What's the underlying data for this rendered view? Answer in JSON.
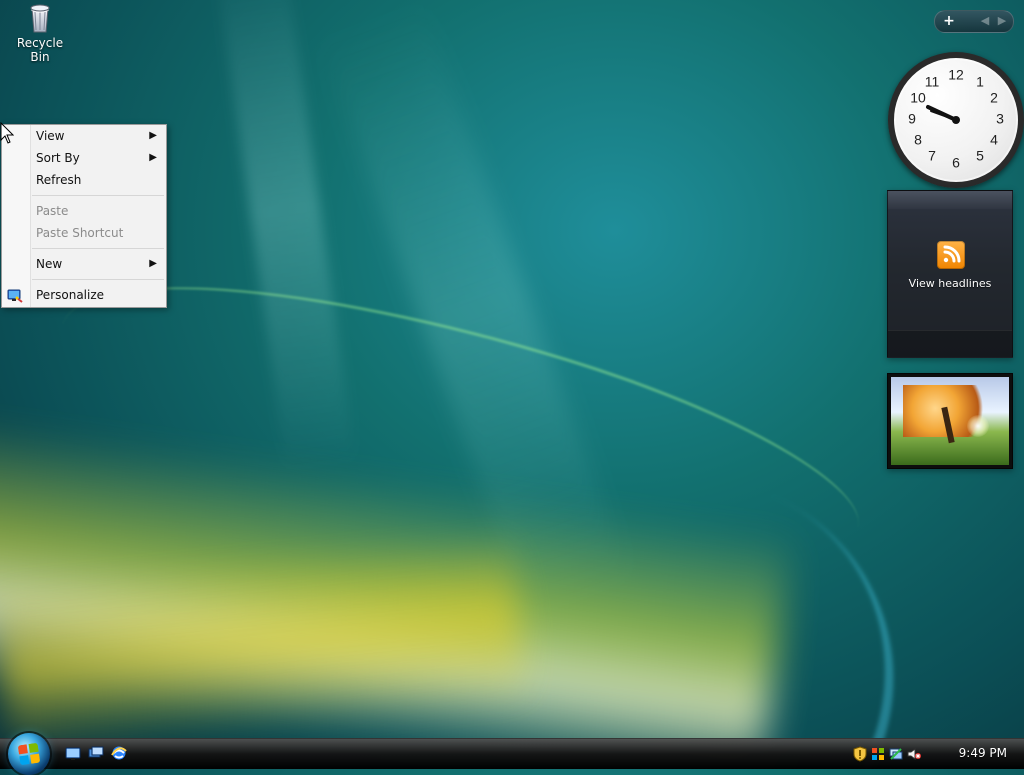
{
  "desktop": {
    "icons": [
      {
        "label": "Recycle Bin",
        "icon": "recycle-bin-icon"
      }
    ]
  },
  "context_menu": {
    "items": [
      {
        "label": "View",
        "disabled": false,
        "submenu": true
      },
      {
        "label": "Sort By",
        "disabled": false,
        "submenu": true
      },
      {
        "label": "Refresh",
        "disabled": false,
        "submenu": false
      },
      {
        "label": "Paste",
        "disabled": true,
        "submenu": false
      },
      {
        "label": "Paste Shortcut",
        "disabled": true,
        "submenu": false
      },
      {
        "label": "New",
        "disabled": false,
        "submenu": true
      },
      {
        "label": "Personalize",
        "disabled": false,
        "submenu": false,
        "icon": "personalize-icon"
      }
    ]
  },
  "sidebar": {
    "controls": {
      "add_label": "+",
      "prev_label": "◀",
      "next_label": "▶"
    },
    "gadgets": {
      "clock": {
        "numbers": [
          "12",
          "1",
          "2",
          "3",
          "4",
          "5",
          "6",
          "7",
          "8",
          "9",
          "10",
          "11"
        ],
        "time_shown": "9:49"
      },
      "rss": {
        "label": "View headlines",
        "icon": "rss-feed-icon"
      },
      "slideshow": {
        "icon": "photo-slideshow"
      }
    }
  },
  "taskbar": {
    "start_icon": "windows-start-orb",
    "quick_launch": [
      {
        "name": "show-desktop",
        "icon": "show-desktop-icon"
      },
      {
        "name": "switch-windows",
        "icon": "switch-windows-icon"
      },
      {
        "name": "internet-explorer",
        "icon": "internet-explorer-icon"
      }
    ],
    "tray": {
      "icons": [
        "security-shield-icon",
        "windows-update-icon",
        "network-icon",
        "volume-muted-icon"
      ],
      "time": "9:49 PM"
    }
  }
}
